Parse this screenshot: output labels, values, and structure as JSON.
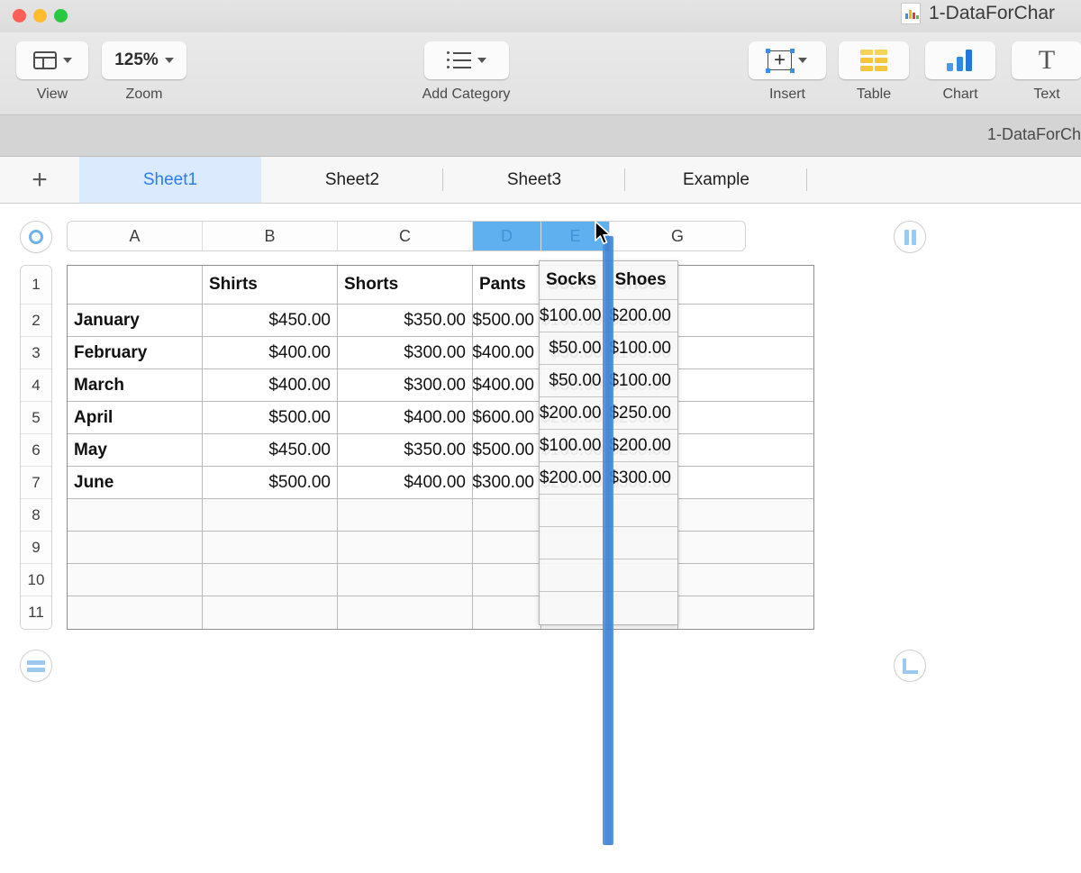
{
  "window": {
    "title": "1-DataForChar",
    "subtitle_title": "1-DataForCh",
    "traffic_lights": [
      "close-button",
      "minimize-button",
      "maximize-button"
    ]
  },
  "toolbar": {
    "items": [
      {
        "name": "view",
        "label": "View",
        "icon": "view-panel-icon",
        "has_chevron": true
      },
      {
        "name": "zoom",
        "label": "Zoom",
        "value": "125%",
        "icon": "zoom-value",
        "has_chevron": true
      },
      {
        "name": "add-category",
        "label": "Add Category",
        "icon": "list-icon",
        "has_chevron": true
      },
      {
        "name": "insert",
        "label": "Insert",
        "icon": "insert-object-icon",
        "has_chevron": true
      },
      {
        "name": "table",
        "label": "Table",
        "icon": "table-icon",
        "has_chevron": false
      },
      {
        "name": "chart",
        "label": "Chart",
        "icon": "bar-chart-icon",
        "has_chevron": false
      },
      {
        "name": "text",
        "label": "Text",
        "icon": "text-icon",
        "has_chevron": false
      }
    ]
  },
  "sheet_tabs": {
    "add_label": "+",
    "tabs": [
      {
        "label": "Sheet1",
        "active": true
      },
      {
        "label": "Sheet2",
        "active": false
      },
      {
        "label": "Sheet3",
        "active": false
      },
      {
        "label": "Example",
        "active": false
      }
    ]
  },
  "canvas": {
    "column_headers": [
      "A",
      "B",
      "C",
      "D",
      "E",
      "G"
    ],
    "selected_columns": [
      "D",
      "E"
    ],
    "row_headers": [
      "1",
      "2",
      "3",
      "4",
      "5",
      "6",
      "7",
      "8",
      "9",
      "10",
      "11"
    ],
    "handles": {
      "top_left": "select-all-handle",
      "top_right": "column-handle",
      "bottom_left": "row-handle",
      "bottom_right": "resize-handle"
    }
  },
  "table": {
    "header_row": [
      "",
      "Shirts",
      "Shorts",
      "Pants",
      "Socks",
      "Shoes",
      ""
    ],
    "rows": [
      {
        "label": "January",
        "cells": [
          "$450.00",
          "$350.00",
          "$500.00",
          "$100.00",
          "$200.00",
          ""
        ]
      },
      {
        "label": "February",
        "cells": [
          "$400.00",
          "$300.00",
          "$400.00",
          "$50.00",
          "$100.00",
          ""
        ]
      },
      {
        "label": "March",
        "cells": [
          "$400.00",
          "$300.00",
          "$400.00",
          "$50.00",
          "$100.00",
          ""
        ]
      },
      {
        "label": "April",
        "cells": [
          "$500.00",
          "$400.00",
          "$600.00",
          "$200.00",
          "$250.00",
          ""
        ]
      },
      {
        "label": "May",
        "cells": [
          "$450.00",
          "$350.00",
          "$500.00",
          "$100.00",
          "$200.00",
          ""
        ]
      },
      {
        "label": "June",
        "cells": [
          "$500.00",
          "$400.00",
          "$300.00",
          "$200.00",
          "$300.00",
          ""
        ]
      }
    ],
    "empty_rows": 4
  },
  "drag_ghost": {
    "header": [
      "Socks",
      "Shoes"
    ],
    "rows": [
      [
        "$100.00",
        "$200.00"
      ],
      [
        "$50.00",
        "$100.00"
      ],
      [
        "$50.00",
        "$100.00"
      ],
      [
        "$200.00",
        "$250.00"
      ],
      [
        "$100.00",
        "$200.00"
      ],
      [
        "$200.00",
        "$300.00"
      ]
    ],
    "empty_rows": 4
  },
  "colors": {
    "accent_blue": "#2b7df0",
    "selection_blue": "#5fb0ef",
    "insert_bar_blue": "#4a8fdc",
    "handle_blue": "#9dc9ee",
    "chart_icon_blue": "#1f7ad8",
    "table_icon_yellow": "#f4c63d"
  }
}
